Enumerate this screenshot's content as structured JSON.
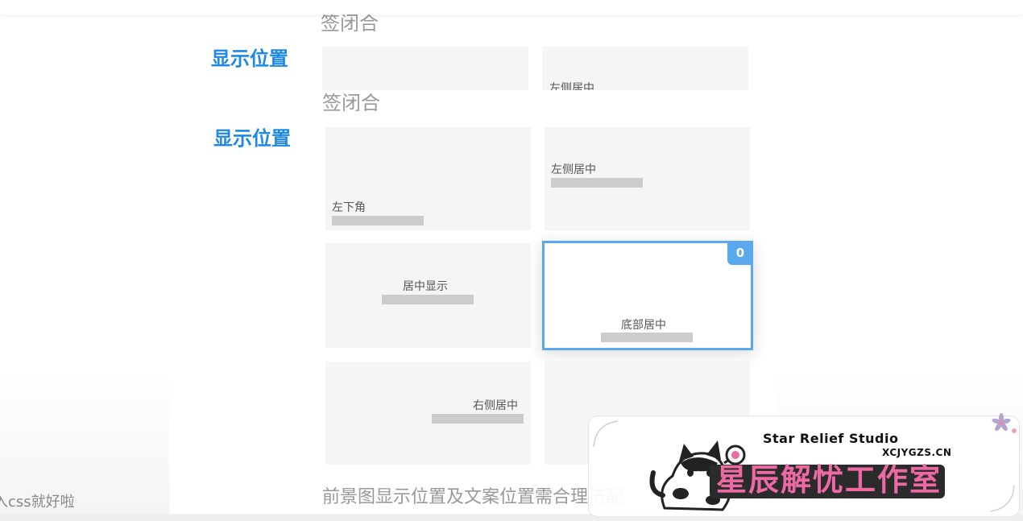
{
  "heading_fragment": "签闭合",
  "display_position_label": "显示位置",
  "top_strip": {
    "card2_label": "左侧居中"
  },
  "grid": {
    "cards": [
      {
        "label": "左下角"
      },
      {
        "label": "左侧居中"
      },
      {
        "label": "居中显示"
      },
      {
        "label": "底部居中",
        "selected": true,
        "badge": "0"
      },
      {
        "label": "右侧居中"
      },
      {
        "label": ""
      }
    ]
  },
  "footer_note": "前景图显示位置及文案位置需合理搭配",
  "left_hint": "入css就好啦",
  "watermark": {
    "studio_en": "Star Relief Studio",
    "domain": "XCJYGZS.CN",
    "studio_cn": "星辰解忧工作室"
  },
  "colors": {
    "accent_blue": "#1e88e5",
    "selection_blue": "#5aa9ee",
    "card_bg": "#f5f5f5",
    "placeholder_bar": "#cccccc",
    "watermark_pink": "#ec6aa4"
  },
  "icons": [
    "cat-mascot-icon",
    "flower-icon"
  ]
}
